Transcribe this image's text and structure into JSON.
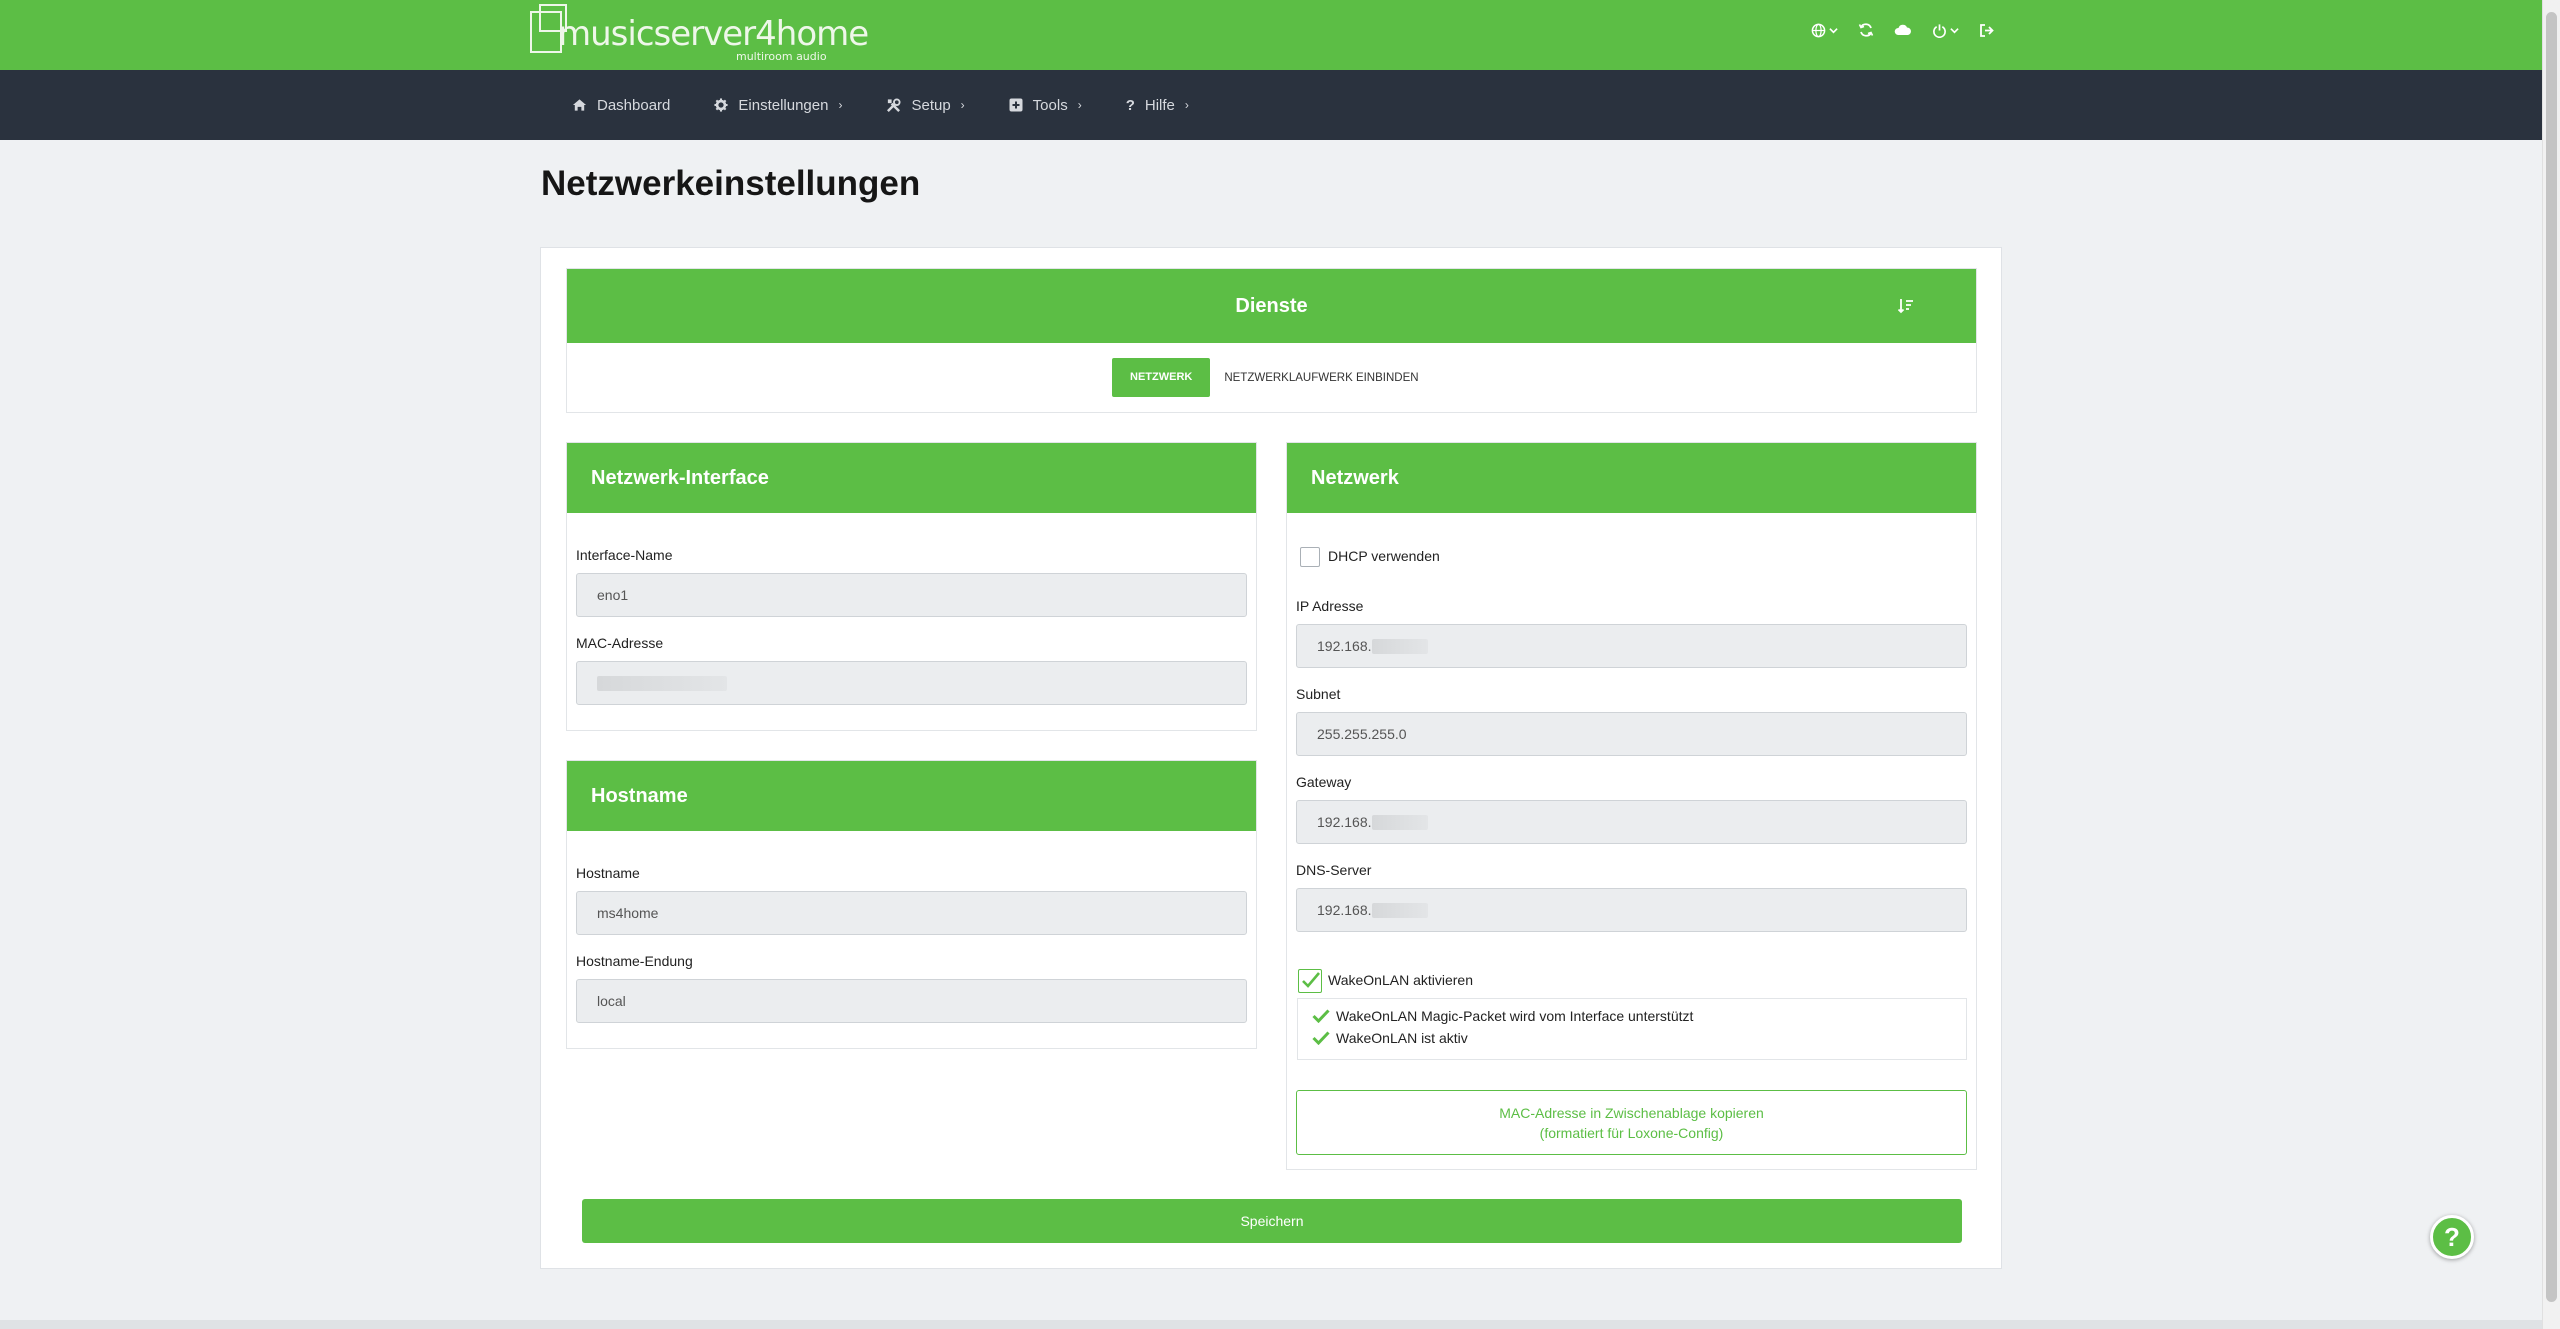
{
  "brand": {
    "name": "musicserver4home",
    "tagline": "multiroom audio"
  },
  "topbar": {
    "icons": [
      "globe-icon",
      "refresh-icon",
      "cloud-icon",
      "power-icon",
      "logout-icon"
    ]
  },
  "nav": {
    "items": [
      {
        "label": "Dashboard",
        "icon": "home-icon"
      },
      {
        "label": "Einstellungen",
        "icon": "gear-icon"
      },
      {
        "label": "Setup",
        "icon": "tools-icon"
      },
      {
        "label": "Tools",
        "icon": "plus-square-icon"
      },
      {
        "label": "Hilfe",
        "icon": "question-icon"
      }
    ],
    "chevron": "›"
  },
  "page": {
    "title": "Netzwerkeinstellungen"
  },
  "dienste": {
    "title": "Dienste",
    "tabs": [
      {
        "label": "NETZWERK",
        "active": true
      },
      {
        "label": "NETZWERKLAUFWERK EINBINDEN",
        "active": false
      }
    ]
  },
  "interface": {
    "title": "Netzwerk-Interface",
    "name_label": "Interface-Name",
    "name_value": "eno1",
    "mac_label": "MAC-Adresse",
    "mac_value": ""
  },
  "hostname": {
    "title": "Hostname",
    "hostname_label": "Hostname",
    "hostname_value": "ms4home",
    "suffix_label": "Hostname-Endung",
    "suffix_value": "local"
  },
  "network": {
    "title": "Netzwerk",
    "dhcp_label": "DHCP verwenden",
    "dhcp_checked": false,
    "ip_label": "IP Adresse",
    "ip_value": "192.168.",
    "subnet_label": "Subnet",
    "subnet_value": "255.255.255.0",
    "gateway_label": "Gateway",
    "gateway_value": "192.168.",
    "dns_label": "DNS-Server",
    "dns_value": "192.168.",
    "wol_label": "WakeOnLAN aktivieren",
    "wol_checked": true,
    "wol_status": [
      "WakeOnLAN Magic-Packet wird vom Interface unterstützt",
      "WakeOnLAN ist aktiv"
    ],
    "copy_button_line1": "MAC-Adresse in Zwischenablage kopieren",
    "copy_button_line2": "(formatiert für Loxone-Config)"
  },
  "actions": {
    "save_label": "Speichern",
    "help_label": "?"
  },
  "colors": {
    "brand_green": "#5cbe45",
    "navbar": "#2a323e",
    "background": "#eff1f3"
  }
}
